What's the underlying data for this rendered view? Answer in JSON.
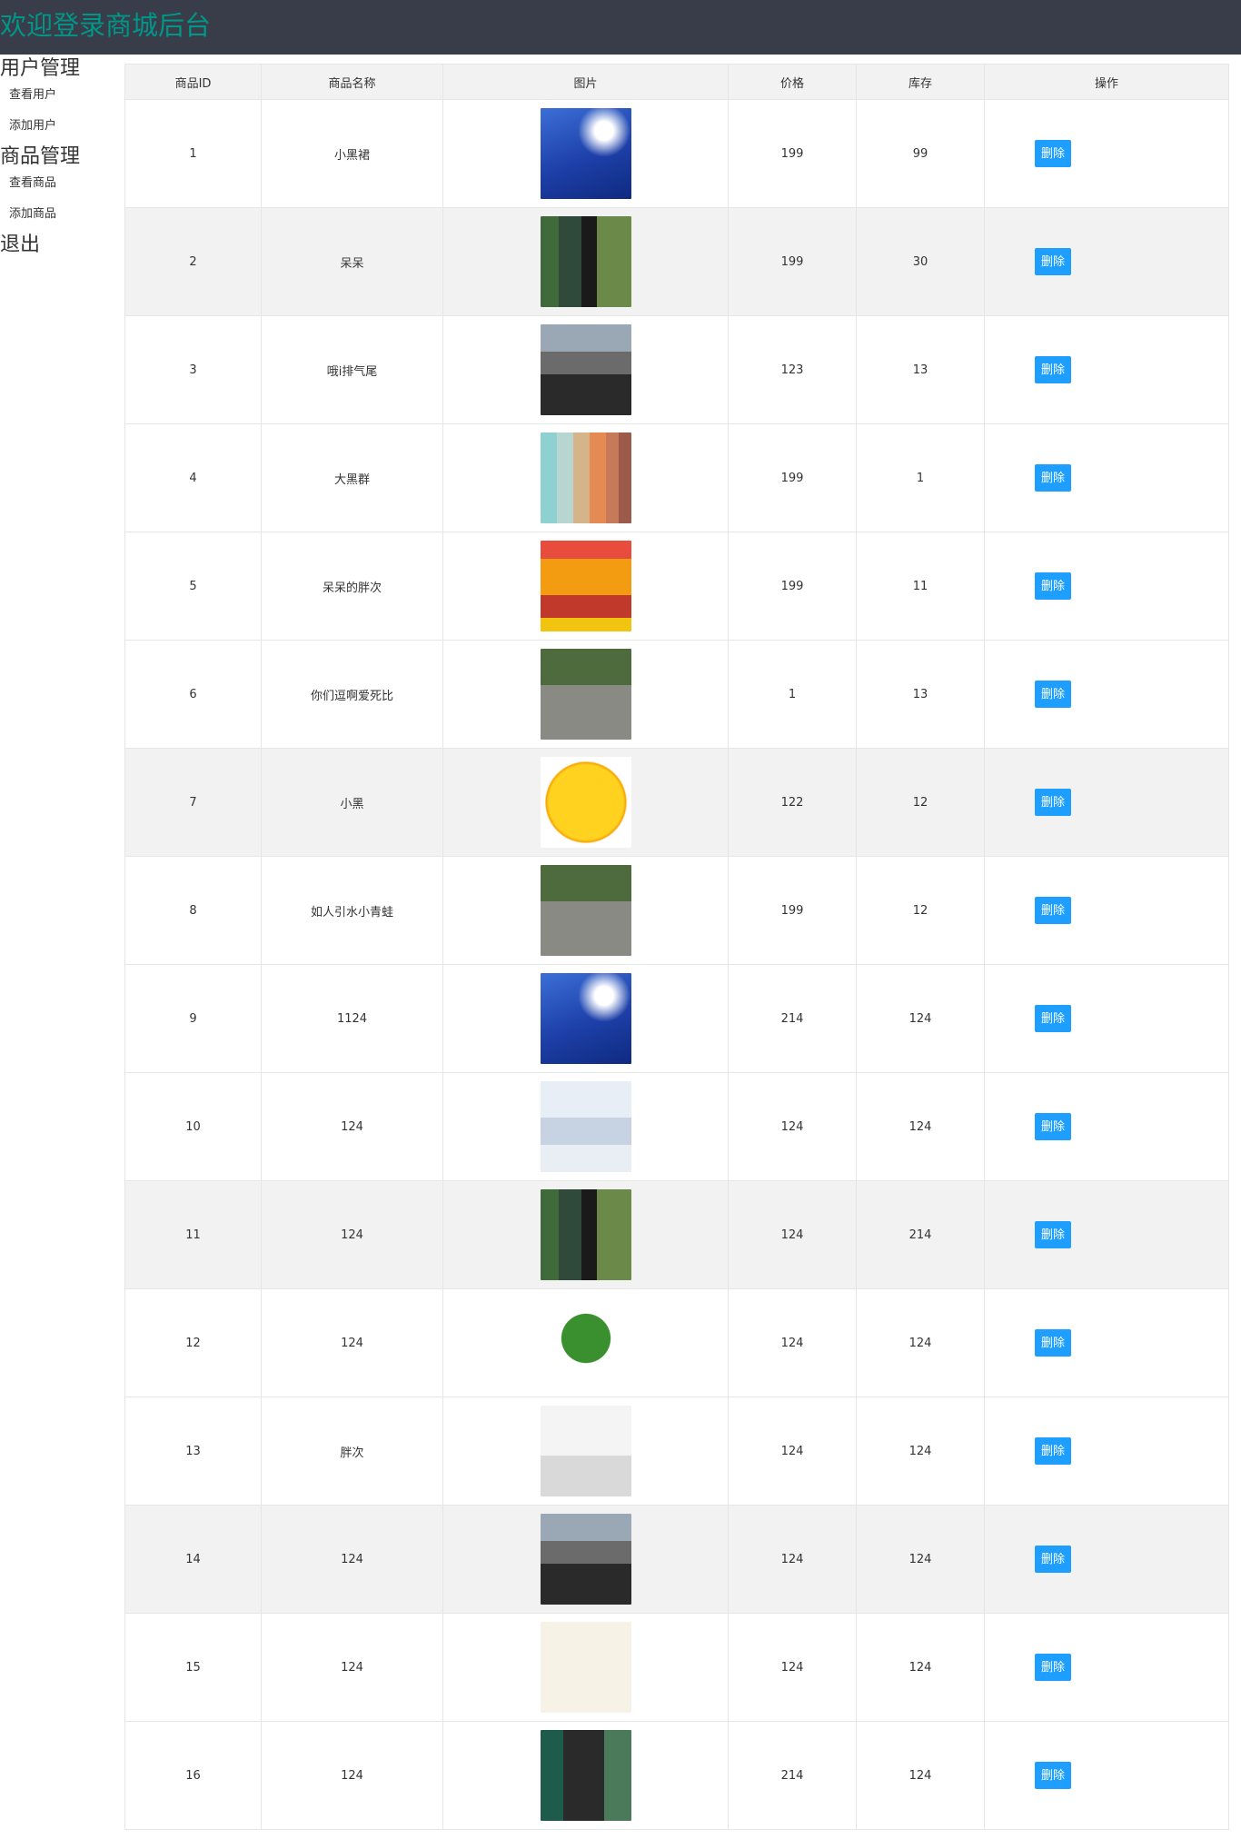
{
  "header": {
    "title": "欢迎登录商城后台"
  },
  "sidebar": {
    "groups": [
      {
        "label": "用户管理",
        "items": [
          "查看用户",
          "添加用户"
        ]
      },
      {
        "label": "商品管理",
        "items": [
          "查看商品",
          "添加商品"
        ]
      },
      {
        "label": "退出",
        "items": []
      }
    ]
  },
  "table": {
    "headers": [
      "商品ID",
      "商品名称",
      "图片",
      "价格",
      "库存",
      "操作"
    ],
    "delete_label": "删除",
    "rows": [
      {
        "id": "1",
        "name": "小黑裙",
        "price": "199",
        "stock": "99",
        "image": "blue-sky-text"
      },
      {
        "id": "2",
        "name": "呆呆",
        "price": "199",
        "stock": "30",
        "image": "woman-black-dress-garden"
      },
      {
        "id": "3",
        "name": "哦i排气尾",
        "price": "123",
        "stock": "13",
        "image": "street-crowd"
      },
      {
        "id": "4",
        "name": "大黑群",
        "price": "199",
        "stock": "1",
        "image": "sunset-sea-strips"
      },
      {
        "id": "5",
        "name": "呆呆的胖次",
        "price": "199",
        "stock": "11",
        "image": "cartoon-city"
      },
      {
        "id": "6",
        "name": "你们逗啊爱死比",
        "price": "1",
        "stock": "13",
        "image": "cat-on-path"
      },
      {
        "id": "7",
        "name": "小黑",
        "price": "122",
        "stock": "12",
        "image": "smiley-face"
      },
      {
        "id": "8",
        "name": "如人引水小青蛙",
        "price": "199",
        "stock": "12",
        "image": "cat-on-path"
      },
      {
        "id": "9",
        "name": "1124",
        "price": "214",
        "stock": "124",
        "image": "blue-sky-text"
      },
      {
        "id": "10",
        "name": "124",
        "price": "124",
        "stock": "124",
        "image": "anime-girl-cloud"
      },
      {
        "id": "11",
        "name": "124",
        "price": "124",
        "stock": "214",
        "image": "woman-black-dress-garden"
      },
      {
        "id": "12",
        "name": "124",
        "price": "124",
        "stock": "124",
        "image": "watermelon-boy"
      },
      {
        "id": "13",
        "name": "胖次",
        "price": "124",
        "stock": "124",
        "image": "misty-tree"
      },
      {
        "id": "14",
        "name": "124",
        "price": "124",
        "stock": "124",
        "image": "street-crowd"
      },
      {
        "id": "15",
        "name": "124",
        "price": "124",
        "stock": "124",
        "image": "plain-cream"
      },
      {
        "id": "16",
        "name": "124",
        "price": "214",
        "stock": "124",
        "image": "woman-portrait"
      }
    ]
  },
  "colors": {
    "header_bg": "#393d49",
    "title": "#009688",
    "delete_button": "#1e9fff",
    "row_alt": "#f2f2f2"
  }
}
